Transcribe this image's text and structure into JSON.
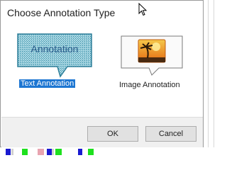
{
  "dialog": {
    "title": "Choose Annotation Type",
    "choices": [
      {
        "label": "Text Annotation",
        "bubble_text": "Annotation",
        "icon": "text-annotation-bubble-icon",
        "selected": true
      },
      {
        "label": "Image Annotation",
        "icon": "image-annotation-bubble-icon",
        "selected": false
      }
    ],
    "ok_label": "OK",
    "cancel_label": "Cancel"
  },
  "colors": {
    "selection": "#1d76d2",
    "bubble_pattern": "#3a8fa8"
  }
}
